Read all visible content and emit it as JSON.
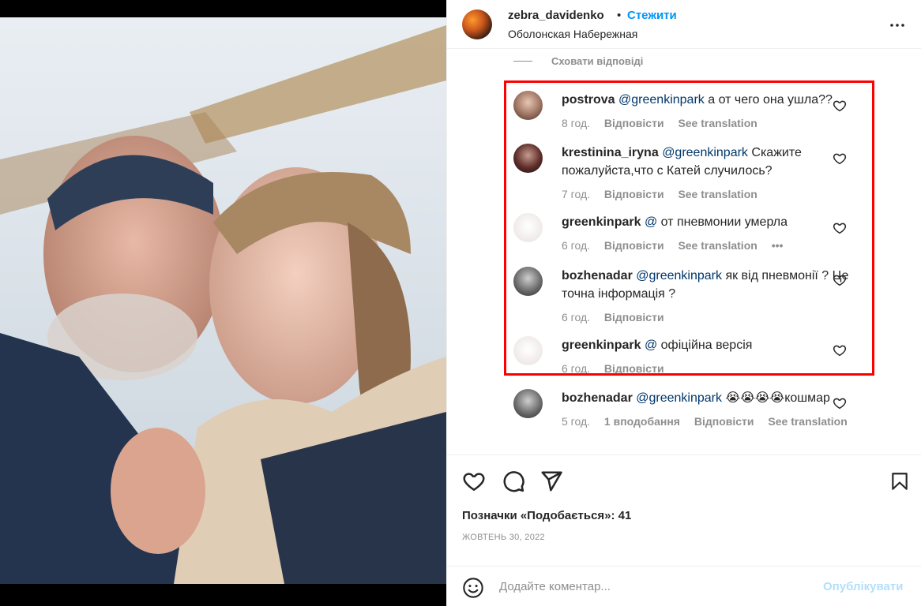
{
  "header": {
    "username": "zebra_davidenko",
    "separator": "•",
    "follow_label": "Стежити",
    "location": "Оболонская Набережная",
    "more_icon": "ellipsis-icon"
  },
  "hide_replies_label": "Сховати відповіді",
  "comments": [
    {
      "username": "postrova",
      "mention": "@greenkinpark",
      "text": " а от чего она ушла??",
      "time": "8 год.",
      "reply_label": "Відповісти",
      "translate_label": "See translation"
    },
    {
      "username": "krestinina_iryna",
      "mention": "@greenkinpark",
      "text": " Скажите пожалуйста,что с Катей случилось?",
      "time": "7 год.",
      "reply_label": "Відповісти",
      "translate_label": "See translation"
    },
    {
      "username": "greenkinpark",
      "mention": "@",
      "text": " от пневмонии умерла",
      "time": "6 год.",
      "reply_label": "Відповісти",
      "translate_label": "See translation",
      "more": "•••"
    },
    {
      "username": "bozhenadar",
      "mention": "@greenkinpark",
      "text": " як від пневмонії ? Це точна інформація ?",
      "time": "6 год.",
      "reply_label": "Відповісти"
    },
    {
      "username": "greenkinpark",
      "mention": "@",
      "text": " офіційна версія",
      "time": "6 год.",
      "reply_label": "Відповісти"
    },
    {
      "username": "bozhenadar",
      "mention": "@greenkinpark",
      "text": " 😭😭😭😭кошмар",
      "time": "5 год.",
      "likes_label": "1 вподобання",
      "reply_label": "Відповісти",
      "translate_label": "See translation"
    }
  ],
  "actions": {
    "like_icon": "heart-icon",
    "comment_icon": "comment-icon",
    "share_icon": "share-icon",
    "save_icon": "bookmark-icon",
    "likes_text": "Позначки «Подобається»: 41",
    "date": "ЖОВТЕНЬ 30, 2022"
  },
  "add_comment": {
    "emoji_icon": "emoji-icon",
    "placeholder": "Додайте коментар...",
    "publish_label": "Опублікувати"
  },
  "colors": {
    "accent": "#0095f6",
    "highlight_border": "#ff0000",
    "mention": "#00376b",
    "secondary_text": "#8e8e8e"
  }
}
